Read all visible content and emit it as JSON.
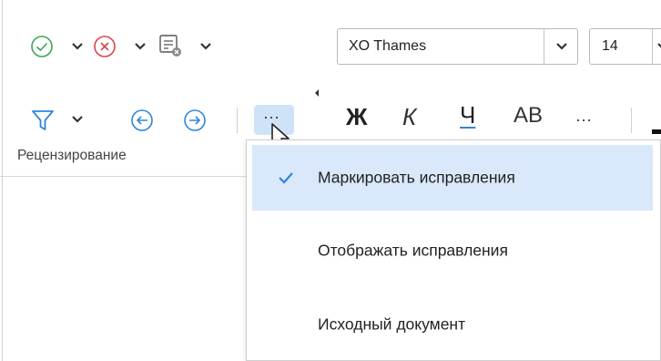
{
  "ribbon": {
    "group_label": "Рецензирование",
    "icons": {
      "accept": "check-circle-icon",
      "reject": "x-circle-icon",
      "comment": "comment-icon",
      "filter": "filter-icon",
      "previous": "arrow-left-circle-icon",
      "next": "arrow-right-circle-icon",
      "more": "more-dots-icon"
    },
    "more_label": "···",
    "font_name": "XO Thames",
    "font_size": "14",
    "format_buttons": {
      "bold": "Ж",
      "italic": "К",
      "underline": "Ч",
      "strike": "АВ",
      "more": "···"
    }
  },
  "menu": {
    "items": [
      {
        "label": "Маркировать исправления",
        "checked": true
      },
      {
        "label": "Отображать исправления",
        "checked": false
      },
      {
        "label": "Исходный документ",
        "checked": false
      }
    ]
  },
  "colors": {
    "accept": "#3aa655",
    "reject": "#e0424f",
    "accent": "#2f86d9",
    "selected_bg": "#d9e8fb",
    "more_button_bg": "#cfe3f8"
  }
}
